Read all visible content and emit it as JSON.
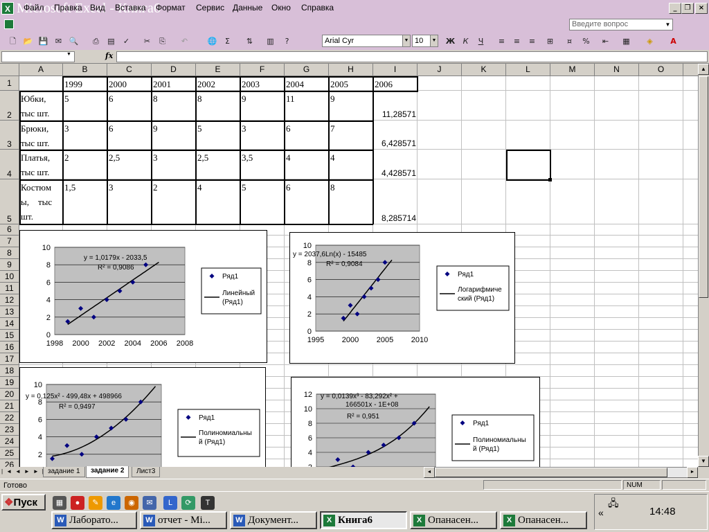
{
  "window": {
    "title": "Microsoft Excel - Книга6",
    "app_icon": "excel-icon",
    "buttons": {
      "minimize": "_",
      "restore": "❐",
      "close": "×"
    }
  },
  "menu": {
    "items": [
      "Файл",
      "Правка",
      "Вид",
      "Вставка",
      "Формат",
      "Сервис",
      "Данные",
      "Окно",
      "Справка"
    ],
    "help_placeholder": "Введите вопрос"
  },
  "toolbar": {
    "font": "Arial Cyr",
    "size": "10",
    "bold": "Ж",
    "italic": "К",
    "underline": "Ч",
    "sum": "Σ"
  },
  "formula": {
    "fx": "fx",
    "name_box": "",
    "value": ""
  },
  "columns": [
    "A",
    "B",
    "C",
    "D",
    "E",
    "F",
    "G",
    "H",
    "I",
    "J",
    "K",
    "L",
    "M",
    "N",
    "O"
  ],
  "rows": [
    "1",
    "2",
    "3",
    "4",
    "5",
    "6",
    "7",
    "8",
    "9",
    "10",
    "11",
    "12",
    "13",
    "14",
    "15",
    "16",
    "17",
    "18",
    "19",
    "20",
    "21",
    "22",
    "23",
    "24",
    "25",
    "26"
  ],
  "table": {
    "years": [
      "1999",
      "2000",
      "2001",
      "2002",
      "2003",
      "2004",
      "2005",
      "2006"
    ],
    "products": [
      {
        "name_line1": "Юбки,",
        "name_line2": "тыс шт.",
        "name_line3": "",
        "values": [
          "5",
          "6",
          "8",
          "8",
          "9",
          "11",
          "9"
        ],
        "forecast": "11,28571"
      },
      {
        "name_line1": "Брюки,",
        "name_line2": "тыс шт.",
        "name_line3": "",
        "values": [
          "3",
          "6",
          "9",
          "5",
          "3",
          "6",
          "7"
        ],
        "forecast": "6,428571"
      },
      {
        "name_line1": "Платья,",
        "name_line2": "тыс шт.",
        "name_line3": "",
        "values": [
          "2",
          "2,5",
          "3",
          "2,5",
          "3,5",
          "4",
          "4"
        ],
        "forecast": "4,428571"
      },
      {
        "name_line1": "Костюм",
        "name_line2": "ы,    тыс",
        "name_line3": "шт.",
        "values": [
          "1,5",
          "3",
          "2",
          "4",
          "5",
          "6",
          "8"
        ],
        "forecast": "8,285714"
      }
    ]
  },
  "chart_data": [
    {
      "type": "scatter",
      "trend": "linear",
      "x": [
        1999,
        2000,
        2001,
        2002,
        2003,
        2004,
        2005
      ],
      "y": [
        1.5,
        3,
        2,
        4,
        5,
        6,
        8
      ],
      "xlim": [
        1998,
        2008
      ],
      "ylim": [
        0,
        10
      ],
      "xticks": [
        "1998",
        "2000",
        "2002",
        "2004",
        "2006",
        "2008"
      ],
      "yticks": [
        "0",
        "2",
        "4",
        "6",
        "8",
        "10"
      ],
      "equation": "y = 1,0179x - 2033,5",
      "r2": "R² = 0,9086",
      "legend": {
        "series": "Ряд1",
        "trend": "Линейный (Ряд1)",
        "trend_line1": "Линейный",
        "trend_line2": "(Ряд1)"
      }
    },
    {
      "type": "scatter",
      "trend": "logarithmic",
      "x": [
        1999,
        2000,
        2001,
        2002,
        2003,
        2004,
        2005
      ],
      "y": [
        1.5,
        3,
        2,
        4,
        5,
        6,
        8
      ],
      "xlim": [
        1995,
        2010
      ],
      "ylim": [
        0,
        10
      ],
      "xticks": [
        "1995",
        "2000",
        "2005",
        "2010"
      ],
      "yticks": [
        "0",
        "2",
        "4",
        "6",
        "8",
        "10"
      ],
      "equation": "y = 2037,6Ln(x) - 15485",
      "r2": "R² = 0,9084",
      "legend": {
        "series": "Ряд1",
        "trend": "Логарифмический (Ряд1)",
        "trend_line1": "Логарифмиче",
        "trend_line2": "ский (Ряд1)"
      }
    },
    {
      "type": "scatter",
      "trend": "polynomial-2",
      "x": [
        1999,
        2000,
        2001,
        2002,
        2003,
        2004,
        2005
      ],
      "y": [
        1.5,
        3,
        2,
        4,
        5,
        6,
        8
      ],
      "ylim": [
        0,
        10
      ],
      "yticks": [
        "2",
        "4",
        "6",
        "8",
        "10"
      ],
      "equation": "y = 0,125x² - 499,48x + 498966",
      "r2": "R² = 0,9497",
      "legend": {
        "series": "Ряд1",
        "trend": "Полиномиальный (Ряд1)",
        "trend_line1": "Полиномиальны",
        "trend_line2": "й (Ряд1)"
      }
    },
    {
      "type": "scatter",
      "trend": "polynomial-3",
      "x": [
        1999,
        2000,
        2001,
        2002,
        2003,
        2004,
        2005
      ],
      "y": [
        1.5,
        3,
        2,
        4,
        5,
        6,
        8
      ],
      "ylim": [
        0,
        12
      ],
      "yticks": [
        "2",
        "4",
        "6",
        "8",
        "10",
        "12"
      ],
      "equation": "y = 0,0139x³ - 83,292x² +",
      "equation2": "166501x - 1E+08",
      "r2": "R² = 0,951",
      "legend": {
        "series": "Ряд1",
        "trend": "Полиномиальный (Ряд1)",
        "trend_line1": "Полиномиальны",
        "trend_line2": "й (Ряд1)"
      }
    }
  ],
  "sheets": {
    "tabs": [
      "задание 1",
      "задание 2",
      "Лист3"
    ],
    "active": "задание 2"
  },
  "status": {
    "left": "Готово",
    "num": "NUM"
  },
  "taskbar": {
    "start": "Пуск",
    "tasks": [
      "Лаборато...",
      "отчет - Mi...",
      "Документ...",
      "Книга6",
      "Опанасен...",
      "Опанасен..."
    ],
    "active_task": "Книга6",
    "clock": "14:48",
    "tray_arrow": "«"
  }
}
